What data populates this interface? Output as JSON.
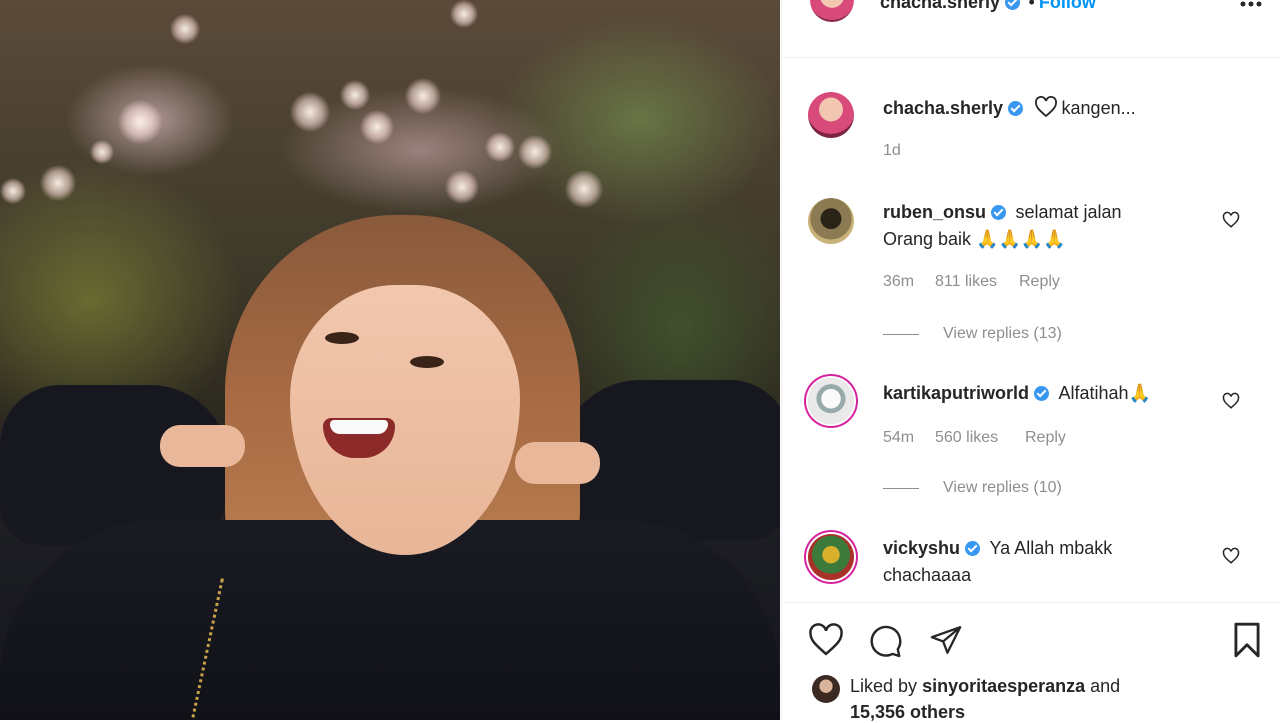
{
  "post": {
    "author": "chacha.sherly",
    "follow_label": "Follow",
    "more_icon": "more-options-icon",
    "caption_text": "kangen...",
    "caption_age": "1d"
  },
  "comments": [
    {
      "username": "ruben_onsu",
      "line1": "selamat jalan",
      "line2": "Orang baik 🙏🙏🙏🙏",
      "age": "36m",
      "likes": "811 likes",
      "reply_label": "Reply",
      "view_replies": "View replies (13)"
    },
    {
      "username": "kartikaputriworld",
      "line1": "Alfatihah🙏",
      "age": "54m",
      "likes": "560 likes",
      "reply_label": "Reply",
      "view_replies": "View replies (10)"
    },
    {
      "username": "vickyshu",
      "line1": "Ya Allah mbakk",
      "line2": "chachaaaa"
    }
  ],
  "liked_by": {
    "prefix": "Liked by",
    "user": "sinyoritaesperanza",
    "and": "and",
    "others": "15,356 others"
  },
  "colors": {
    "verified": "#3897f0",
    "follow": "#0095f6",
    "muted": "#8e8e8e",
    "story_ring": "#d6249f"
  }
}
